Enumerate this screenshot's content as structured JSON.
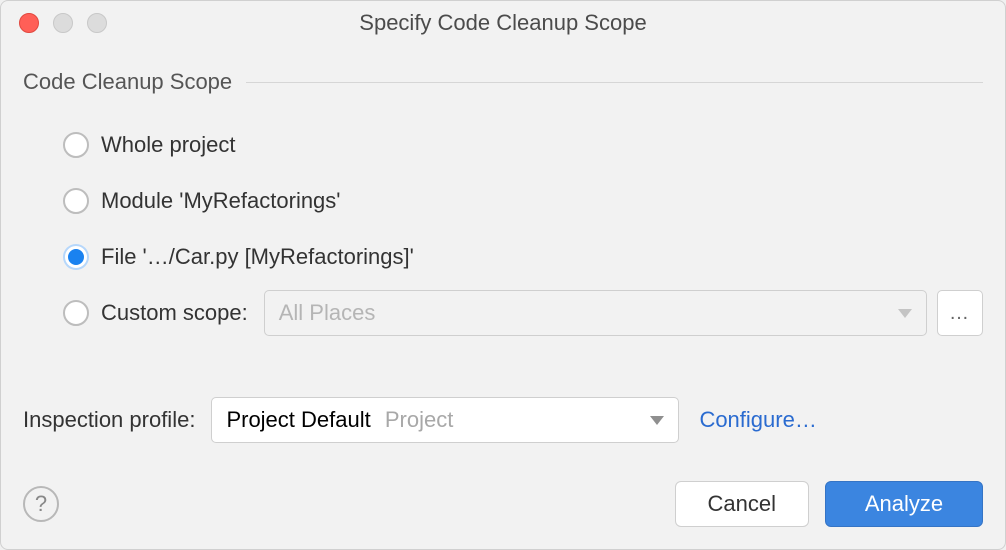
{
  "window": {
    "title": "Specify Code Cleanup Scope"
  },
  "group": {
    "title": "Code Cleanup Scope"
  },
  "options": {
    "whole_project": "Whole project",
    "module": "Module 'MyRefactorings'",
    "file": "File '…/Car.py [MyRefactorings]'",
    "custom_scope_label": "Custom scope:"
  },
  "custom_scope_dropdown": {
    "value": "All Places"
  },
  "profile": {
    "label": "Inspection profile:",
    "value": "Project Default",
    "secondary": "Project",
    "configure": "Configure…"
  },
  "buttons": {
    "cancel": "Cancel",
    "analyze": "Analyze"
  },
  "dots": "…"
}
